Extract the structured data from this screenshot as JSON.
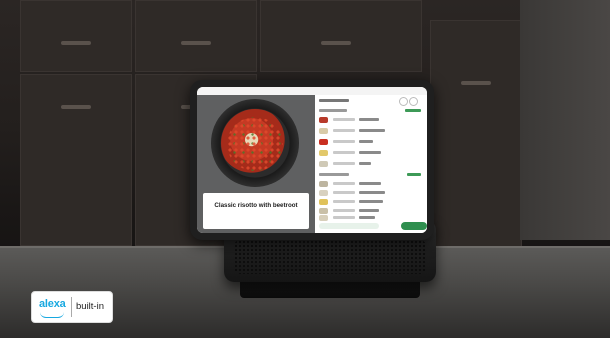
{
  "tablet_screen": {
    "recipe_title": "Classic risotto with beetroot",
    "recipe_subtitle": ""
  },
  "badge": {
    "alexa_label": "alexa",
    "builtin_label": "built-in",
    "alexa_color": "#17a8e0"
  },
  "colors": {
    "accent_green": "#2f8f4f",
    "tablet_bezel": "#1f1f1f"
  }
}
